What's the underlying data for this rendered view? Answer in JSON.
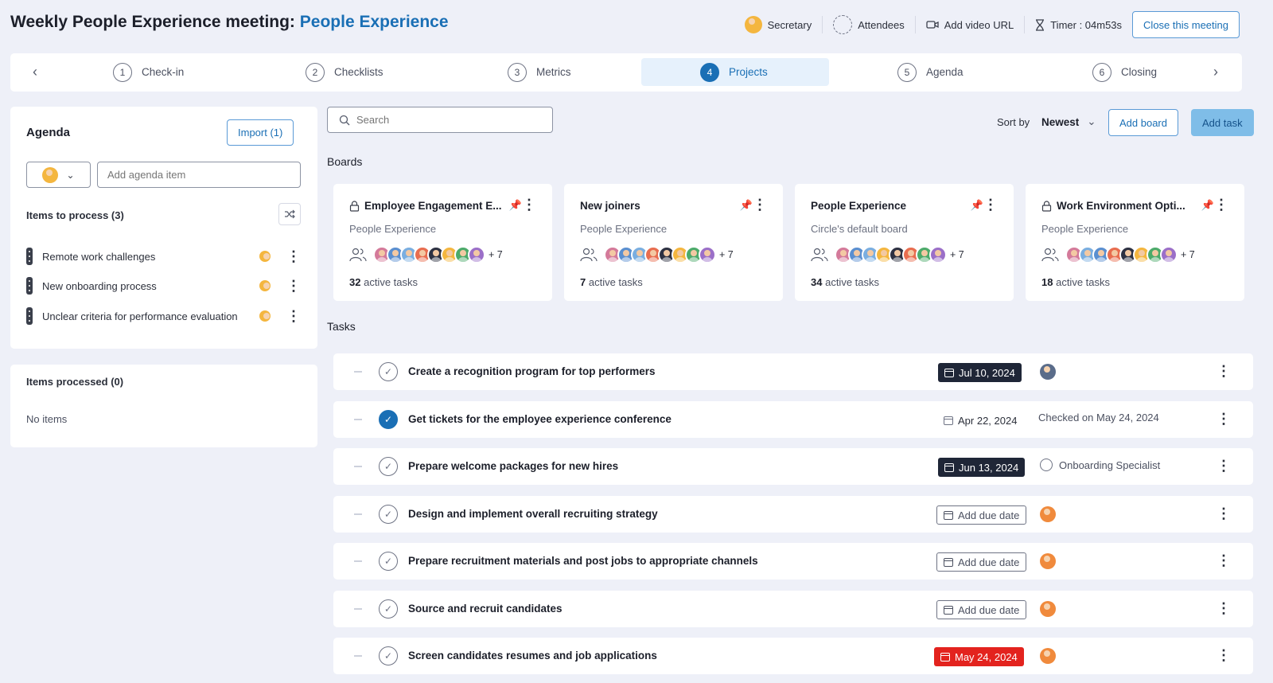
{
  "header": {
    "title_prefix": "Weekly People Experience meeting:",
    "title_accent": "People Experience",
    "secretary_label": "Secretary",
    "attendees_label": "Attendees",
    "video_label": "Add video URL",
    "timer_label": "Timer : 04m53s",
    "close_button": "Close this meeting"
  },
  "stepper": {
    "steps": [
      {
        "num": "1",
        "label": "Check-in"
      },
      {
        "num": "2",
        "label": "Checklists"
      },
      {
        "num": "3",
        "label": "Metrics"
      },
      {
        "num": "4",
        "label": "Projects"
      },
      {
        "num": "5",
        "label": "Agenda"
      },
      {
        "num": "6",
        "label": "Closing"
      }
    ],
    "active_index": 3
  },
  "agenda": {
    "title": "Agenda",
    "import_button": "Import (1)",
    "add_placeholder": "Add agenda item",
    "to_process_title": "Items to process (3)",
    "items": [
      {
        "label": "Remote work challenges"
      },
      {
        "label": "New onboarding process"
      },
      {
        "label": "Unclear criteria for performance evaluation"
      }
    ],
    "processed_title": "Items processed (0)",
    "processed_empty": "No items"
  },
  "toolbar": {
    "search_placeholder": "Search",
    "sort_label": "Sort by",
    "sort_value": "Newest",
    "add_board": "Add board",
    "add_task": "Add task"
  },
  "boards_label": "Boards",
  "boards": [
    {
      "title": "Employee Engagement E...",
      "subtitle": "People Experience",
      "more": "+ 7",
      "count": "32",
      "count_suffix": "active tasks",
      "locked": true
    },
    {
      "title": "New joiners",
      "subtitle": "People Experience",
      "more": "+ 7",
      "count": "7",
      "count_suffix": "active tasks",
      "locked": false
    },
    {
      "title": "People Experience",
      "subtitle": "Circle's default board",
      "more": "+ 7",
      "count": "34",
      "count_suffix": "active tasks",
      "locked": false
    },
    {
      "title": "Work Environment Opti...",
      "subtitle": "People Experience",
      "more": "+ 7",
      "count": "18",
      "count_suffix": "active tasks",
      "locked": true
    }
  ],
  "tasks_label": "Tasks",
  "tasks": [
    {
      "name": "Create a recognition program for top performers",
      "due": "Jul 10, 2024",
      "due_style": "dark",
      "assignee": "",
      "done": false
    },
    {
      "name": "Get tickets for the employee experience conference",
      "due": "Apr 22, 2024",
      "due_style": "plain",
      "assignee": "Checked on May 24, 2024",
      "done": true
    },
    {
      "name": "Prepare welcome packages for new hires",
      "due": "Jun 13, 2024",
      "due_style": "dark",
      "assignee": "Onboarding Specialist",
      "done": false
    },
    {
      "name": "Design and implement overall recruiting strategy",
      "due": "Add due date",
      "due_style": "add",
      "assignee": "",
      "done": false
    },
    {
      "name": "Prepare recruitment materials and post jobs to appropriate channels",
      "due": "Add due date",
      "due_style": "add",
      "assignee": "",
      "done": false
    },
    {
      "name": "Source and recruit candidates",
      "due": "Add due date",
      "due_style": "add",
      "assignee": "",
      "done": false
    },
    {
      "name": "Screen candidates resumes and job applications",
      "due": "May 24, 2024",
      "due_style": "red",
      "assignee": "",
      "done": false
    }
  ],
  "colors": {
    "accent": "#1a6fb5",
    "overdue": "#e3231e",
    "dark_badge": "#1f2637"
  }
}
